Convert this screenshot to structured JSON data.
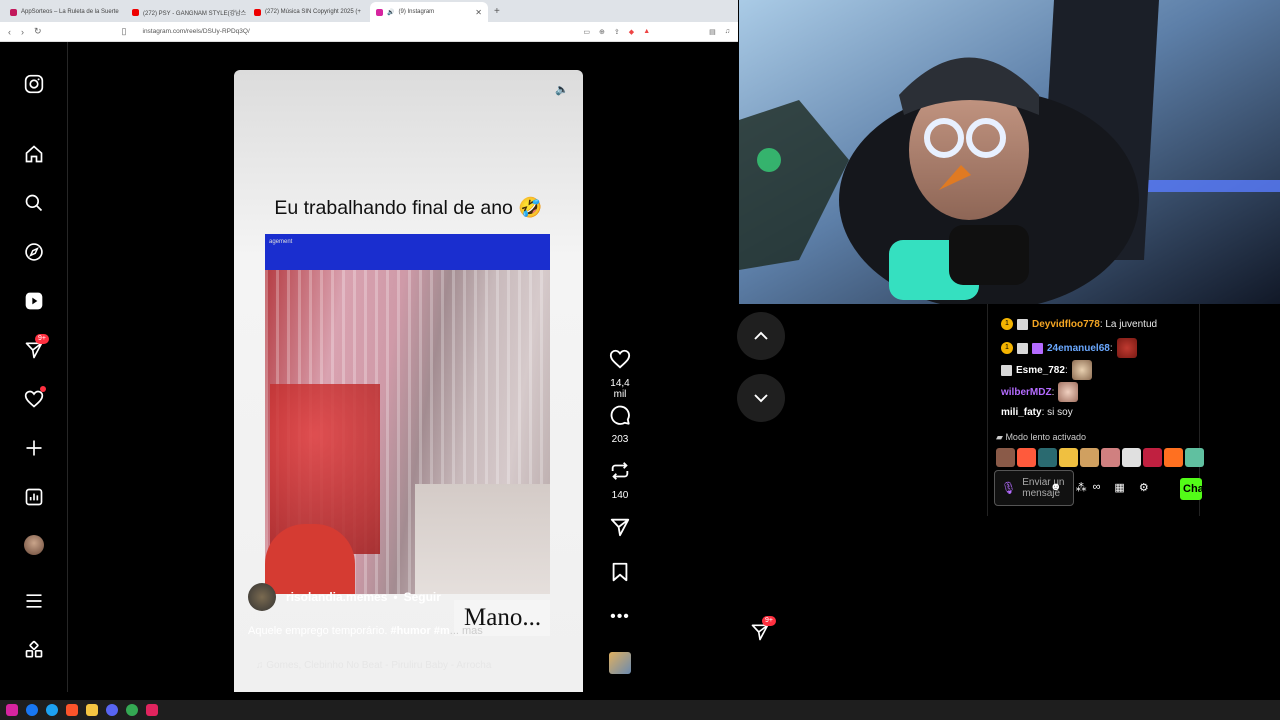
{
  "browser": {
    "tabs": [
      {
        "label": "AppSorteos – La Ruleta de la Suerte",
        "color": "#c2185b"
      },
      {
        "label": "(272) PSY - GANGNAM STYLE(강남스",
        "color": "#e00"
      },
      {
        "label": "(272) Música SIN Copyright 2025 (+",
        "color": "#e00"
      },
      {
        "label": "(9) Instagram",
        "color": "#d6249f",
        "active": true
      }
    ],
    "new_tab": "+",
    "url": "instagram.com/reels/DSUy-RPDq3Q/"
  },
  "instagram": {
    "sidebar": [
      {
        "icon": "instagram-logo-icon",
        "label": "Instagram"
      },
      {
        "icon": "home-icon",
        "label": "Home"
      },
      {
        "icon": "search-icon",
        "label": "Search"
      },
      {
        "icon": "explore-icon",
        "label": "Explore"
      },
      {
        "icon": "reels-icon",
        "label": "Reels"
      },
      {
        "icon": "messages-icon",
        "label": "Messages",
        "badge": "9+"
      },
      {
        "icon": "notifications-icon",
        "label": "Notifications"
      },
      {
        "icon": "create-icon",
        "label": "Create"
      },
      {
        "icon": "dashboard-icon",
        "label": "Dashboard"
      },
      {
        "icon": "profile-avatar",
        "label": "Profile"
      },
      {
        "icon": "menu-icon",
        "label": "More"
      },
      {
        "icon": "also-from-meta-icon",
        "label": "Also from Meta"
      }
    ],
    "reel": {
      "headline": "Eu trabalhando final de ano 🤣",
      "video_strip_text": "agement",
      "username": "risolandia.memes",
      "separator": "•",
      "follow": "Seguir",
      "overlay_text": "Mano...",
      "caption_text": "Aquele emprego temporário. ",
      "caption_tag": "#humor #m",
      "caption_more": "... mas",
      "music": "♫ Gomes, Clebinho No Beat - Piruliru Baby - Arrocha"
    },
    "actions": {
      "likes": "14,4 mil",
      "comments": "203",
      "reposts": "140"
    },
    "dm_badge": "9+"
  },
  "chat": {
    "messages": [
      {
        "user": "Deyvidfloo778",
        "user_color": "#f5a623",
        "text": ": La juventud",
        "badges": 2
      },
      {
        "user": "24emanuel68",
        "user_color": "#6aa8ff",
        "text": ":",
        "badges": 3,
        "emote": true
      },
      {
        "user": "Esme_782",
        "user_color": "#ffffff",
        "text": ":",
        "badges": 1,
        "emote": true
      },
      {
        "user": "wilberMDZ",
        "user_color": "#b46bff",
        "text": ":",
        "badges": 0,
        "emote": true
      },
      {
        "user": "mili_faty",
        "user_color": "#ffffff",
        "text": ": si soy",
        "badges": 0
      }
    ],
    "slow_mode": "Modo lento activado",
    "input_placeholder": "Enviar un mensaje",
    "send_label": "Chat",
    "emote_colors": [
      "#8a5a48",
      "#ff5a3c",
      "#2a6a70",
      "#f0c040",
      "#d0a060",
      "#d08080",
      "#e0e0e0",
      "#c02040",
      "#ff7020",
      "#60c0a0"
    ]
  }
}
